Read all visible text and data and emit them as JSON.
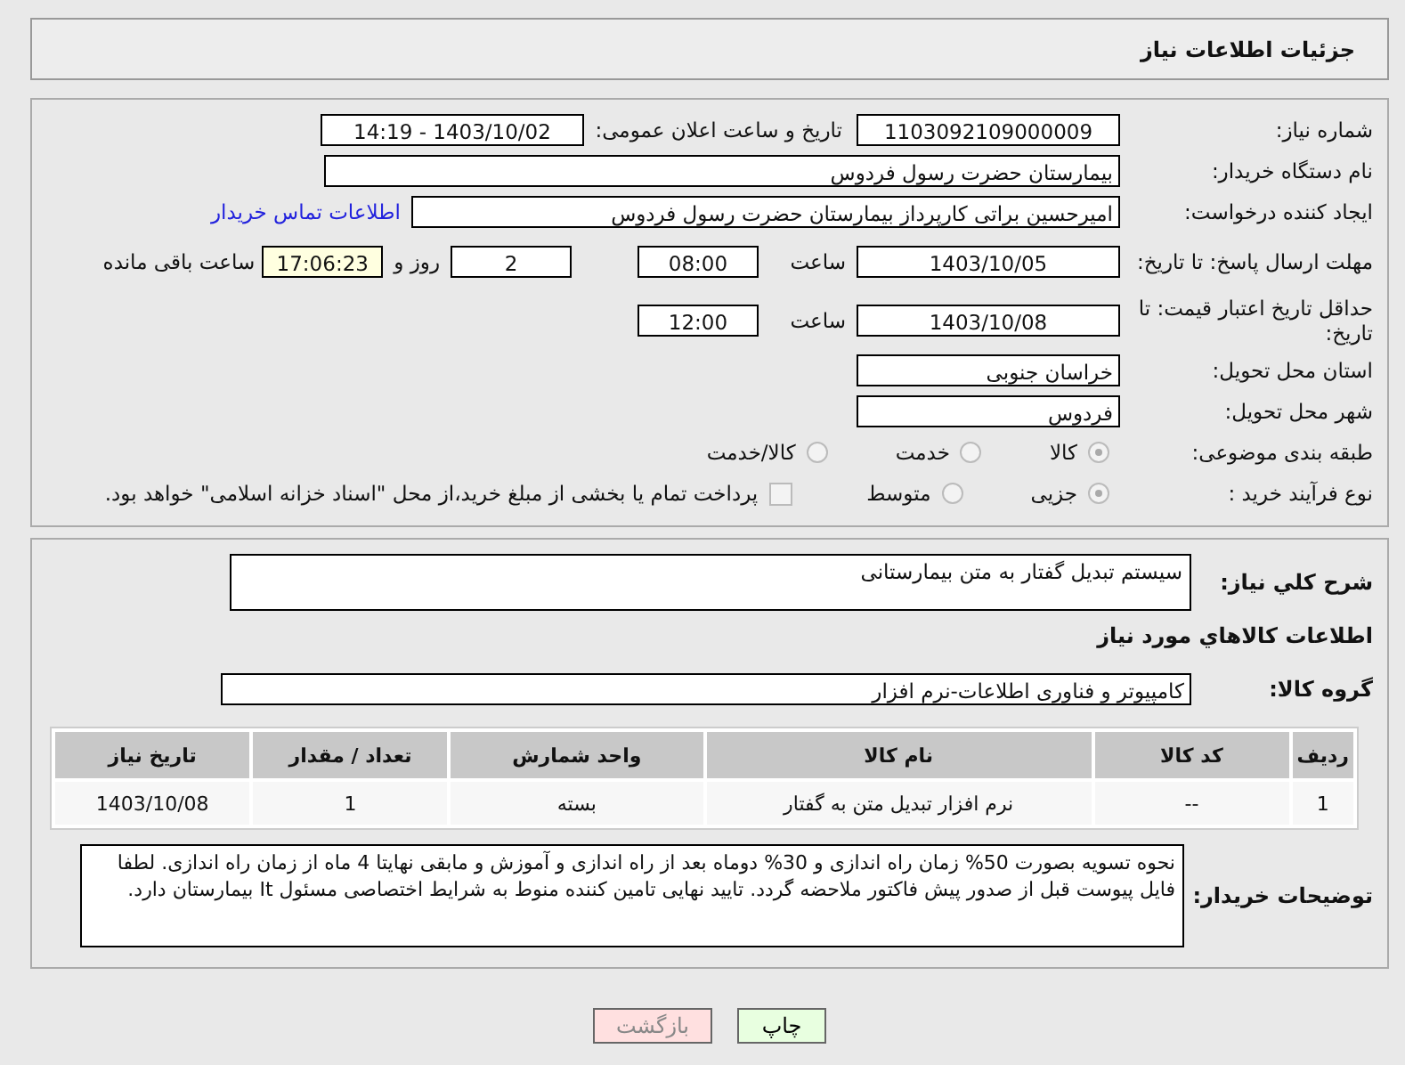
{
  "header": {
    "title": "جزئیات اطلاعات نیاز"
  },
  "need_number": {
    "label": "شماره نیاز:",
    "value": "1103092109000009"
  },
  "announce": {
    "label": "تاریخ و ساعت اعلان عمومی:",
    "value": "1403/10/02 - 14:19"
  },
  "buyer_org": {
    "label": "نام دستگاه خریدار:",
    "value": "بیمارستان حضرت رسول فردوس"
  },
  "creator": {
    "label": "ایجاد کننده درخواست:",
    "value": "امیرحسین براتی کارپرداز بیمارستان حضرت رسول فردوس",
    "link": "اطلاعات تماس خریدار"
  },
  "reply_deadline": {
    "label": "مهلت ارسال پاسخ: تا تاریخ:",
    "date": "1403/10/05",
    "time_label": "ساعت",
    "time": "08:00",
    "days": "2",
    "days_label": "روز و",
    "remaining": "17:06:23",
    "remaining_label": "ساعت باقی مانده"
  },
  "price_validity": {
    "label": "حداقل تاریخ اعتبار قیمت: تا تاریخ:",
    "date": "1403/10/08",
    "time_label": "ساعت",
    "time": "12:00"
  },
  "province": {
    "label": "استان محل تحویل:",
    "value": "خراسان جنوبی"
  },
  "city": {
    "label": "شهر محل تحویل:",
    "value": "فردوس"
  },
  "category": {
    "label": "طبقه بندی موضوعی:",
    "options": [
      {
        "label": "کالا",
        "selected": true
      },
      {
        "label": "خدمت",
        "selected": false
      },
      {
        "label": "کالا/خدمت",
        "selected": false
      }
    ]
  },
  "purchase_type": {
    "label": "نوع فرآیند خرید :",
    "options": [
      {
        "label": "جزیی",
        "selected": true
      },
      {
        "label": "متوسط",
        "selected": false
      }
    ],
    "treasury": {
      "checked": false,
      "label": "پرداخت تمام یا بخشی از مبلغ خرید،از محل \"اسناد خزانه اسلامی\" خواهد بود."
    }
  },
  "summary": {
    "label": "شرح کلي نياز:",
    "value": "سیستم تبدیل گفتار به متن بیمارستانی"
  },
  "goods_heading": "اطلاعات کالاهاي مورد نياز",
  "goods_group": {
    "label": "گروه کالا:",
    "value": "کامپیوتر و فناوری اطلاعات-نرم افزار"
  },
  "table": {
    "columns": [
      "ردیف",
      "کد کالا",
      "نام کالا",
      "واحد شمارش",
      "تعداد / مقدار",
      "تاریخ نیاز"
    ],
    "rows": [
      [
        "1",
        "--",
        "نرم افزار تبدیل متن به گفتار",
        "بسته",
        "1",
        "1403/10/08"
      ]
    ]
  },
  "buyer_notes": {
    "label": "توضیحات خریدار:",
    "value": "نحوه تسویه بصورت 50% زمان راه اندازی و 30% دوماه بعد از راه اندازی و آموزش و مابقی نهایتا 4 ماه از زمان راه اندازی. لطفا فایل پیوست قبل از صدور پیش فاکتور ملاحضه گردد. تایید نهایی تامین کننده منوط به شرایط اختصاصی مسئول It  بیمارستان دارد."
  },
  "buttons": [
    {
      "label": "چاپ",
      "kind": "print"
    },
    {
      "label": "بازگشت",
      "kind": "back"
    }
  ]
}
